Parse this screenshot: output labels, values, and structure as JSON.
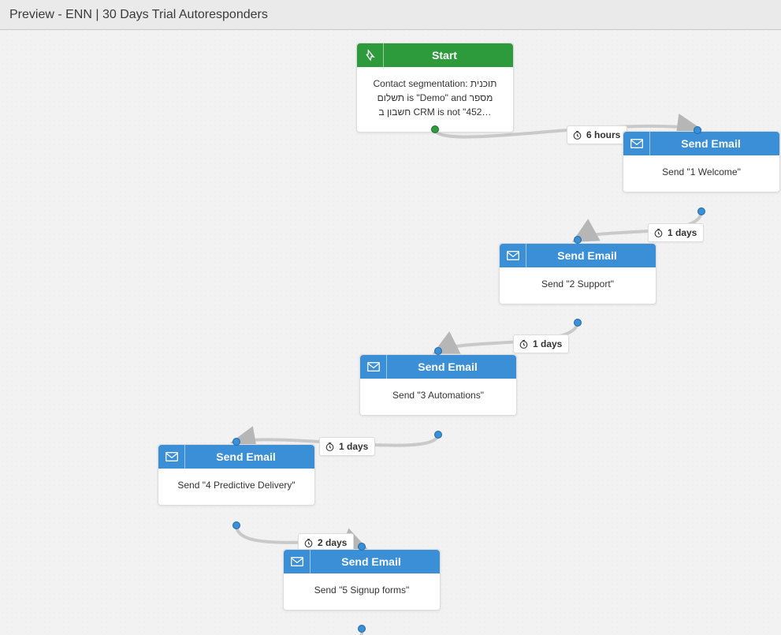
{
  "header": {
    "title": "Preview - ENN | 30 Days Trial Autoresponders"
  },
  "colors": {
    "start": "#2d9b3b",
    "action": "#3a8fd6"
  },
  "nodes": {
    "start": {
      "title": "Start",
      "body": "Contact segmentation: תוכנית תשלום is \"Demo\" and מספר חשבון ב CRM is not \"452…"
    },
    "email1": {
      "title": "Send Email",
      "body": "Send \"1 Welcome\""
    },
    "email2": {
      "title": "Send Email",
      "body": "Send \"2 Support\""
    },
    "email3": {
      "title": "Send Email",
      "body": "Send \"3 Automations\""
    },
    "email4": {
      "title": "Send Email",
      "body": "Send \"4 Predictive Delivery\""
    },
    "email5": {
      "title": "Send Email",
      "body": "Send \"5 Signup forms\""
    }
  },
  "delays": {
    "d1": "6 hours",
    "d2": "1 days",
    "d3": "1 days",
    "d4": "1 days",
    "d5": "2 days"
  }
}
